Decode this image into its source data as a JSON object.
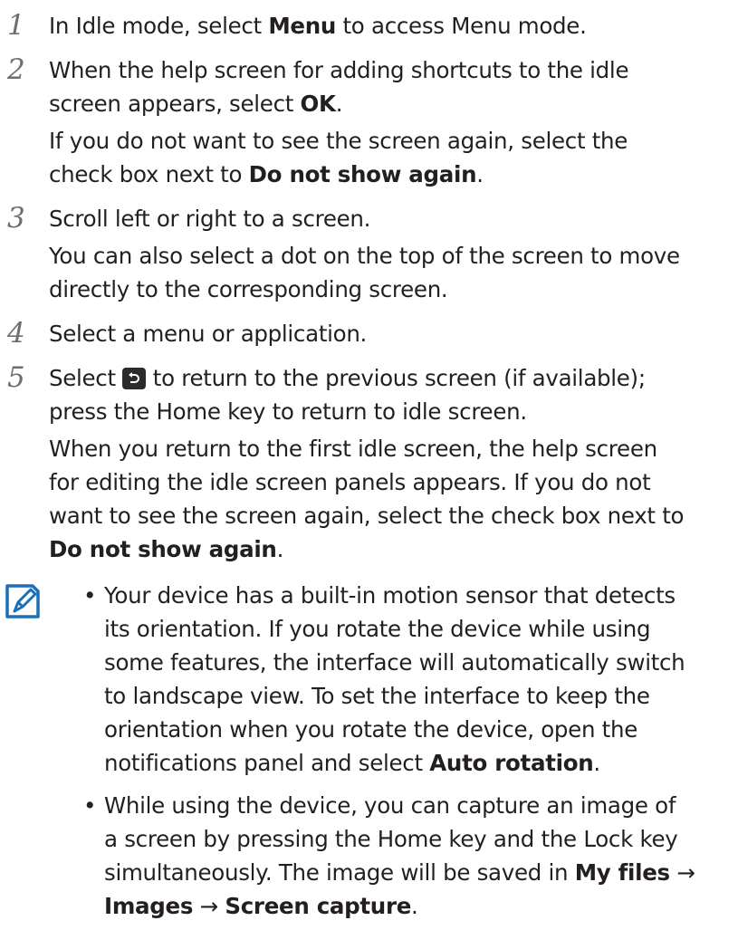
{
  "steps": [
    {
      "num": "1",
      "lines": [
        {
          "text1": "In Idle mode, select ",
          "bold1": "Menu",
          "text2": " to access Menu mode."
        }
      ]
    },
    {
      "num": "2",
      "p1": {
        "text1": "When the help screen for adding shortcuts to the idle\nscreen appears, select ",
        "bold1": "OK",
        "text2": "."
      },
      "p2": {
        "text1": "If you do not want to see the screen again, select the\ncheck box next to ",
        "bold1": "Do not show again",
        "text2": "."
      }
    },
    {
      "num": "3",
      "p1": {
        "text1": "Scroll left or right to a screen."
      },
      "p2": {
        "text1": "You can also select a dot on the top of the screen to move\ndirectly to the corresponding screen."
      }
    },
    {
      "num": "4",
      "p1": {
        "text1": "Select a menu or application."
      }
    },
    {
      "num": "5",
      "p1": {
        "text1": "Select ",
        "icon": "back-icon",
        "text2": " to return to the previous screen (if available);\npress the Home key to return to idle screen."
      },
      "p2": {
        "text1": "When you return to the first idle screen, the help screen\nfor editing the idle screen panels appears. If you do not\nwant to see the screen again, select the check box next to\n",
        "bold1": "Do not show again",
        "text2": "."
      }
    }
  ],
  "note": {
    "icon": "note-pencil-icon",
    "bullets": [
      {
        "text1": "Your device has a built-in motion sensor that detects\nits orientation. If you rotate the device while using\nsome features, the interface will automatically switch\nto landscape view. To set the interface to keep the\norientation when you rotate the device, open the\nnotifications panel and select ",
        "bold1": "Auto rotation",
        "text2": "."
      },
      {
        "text1": "While using the device, you can capture an image of\na screen by pressing the Home key and the Lock key\nsimultaneously. The image will be saved in ",
        "bold1": "My files",
        "arrow1": " →\n",
        "bold2": "Images",
        "arrow2": " → ",
        "bold3": "Screen capture",
        "text2": "."
      }
    ]
  },
  "colors": {
    "text": "#231f20",
    "step_number": "#6d6e71",
    "note_icon": "#1a6fb8",
    "back_icon_bg": "#2b2b2b"
  }
}
